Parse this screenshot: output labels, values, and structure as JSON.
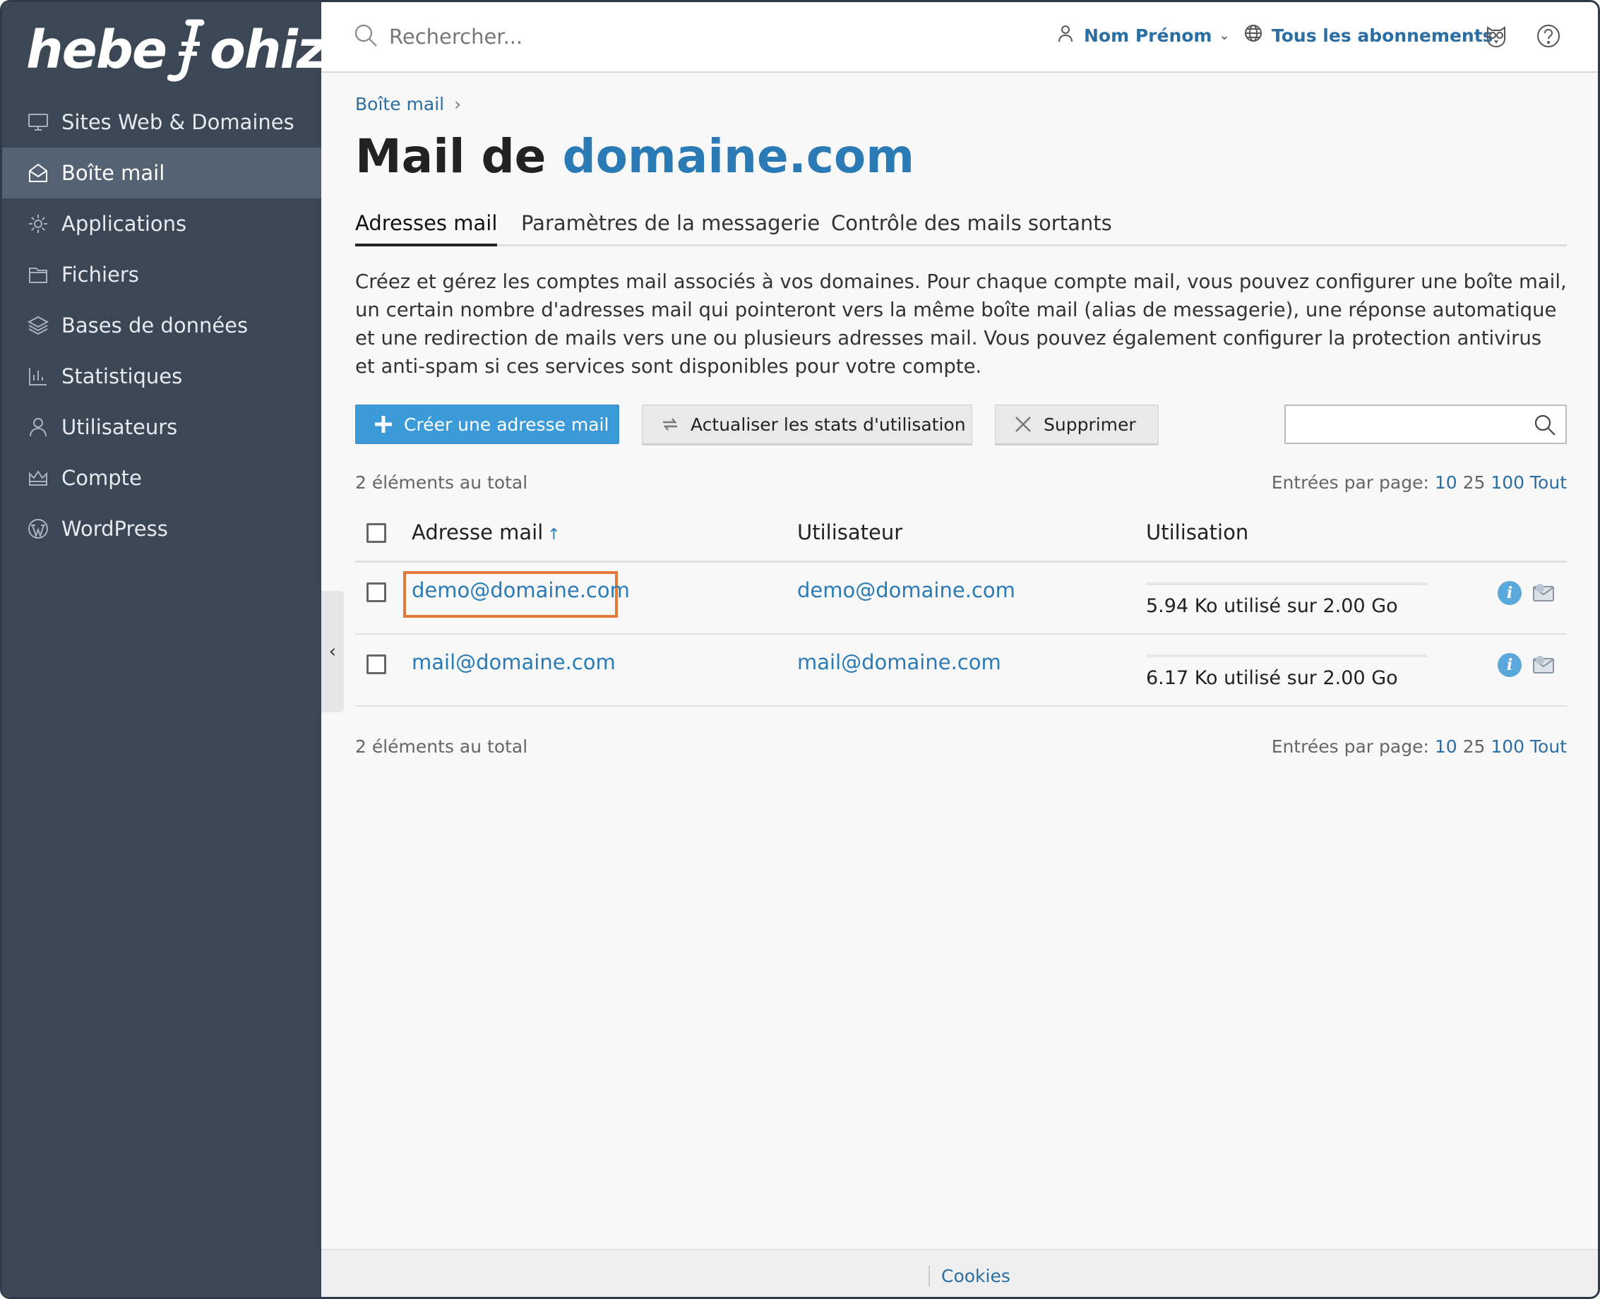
{
  "brand": {
    "logo_text_left": "hebe",
    "logo_text_right": "ohiz"
  },
  "sidebar": {
    "items": [
      {
        "label": "Sites Web & Domaines",
        "icon": "monitor-icon",
        "active": false
      },
      {
        "label": "Boîte mail",
        "icon": "mail-open-icon",
        "active": true
      },
      {
        "label": "Applications",
        "icon": "gear-icon",
        "active": false
      },
      {
        "label": "Fichiers",
        "icon": "folder-icon",
        "active": false
      },
      {
        "label": "Bases de données",
        "icon": "layers-icon",
        "active": false
      },
      {
        "label": "Statistiques",
        "icon": "bar-chart-icon",
        "active": false
      },
      {
        "label": "Utilisateurs",
        "icon": "user-icon",
        "active": false
      },
      {
        "label": "Compte",
        "icon": "crown-icon",
        "active": false
      },
      {
        "label": "WordPress",
        "icon": "wordpress-icon",
        "active": false
      }
    ],
    "collapse_glyph": "‹"
  },
  "header": {
    "search_placeholder": "Rechercher...",
    "user_name": "Nom Prénom",
    "subscriptions_label": "Tous les abonnements"
  },
  "main": {
    "breadcrumb": "Boîte mail",
    "title_prefix": "Mail de",
    "title_domain": "domaine.com",
    "tabs": [
      {
        "label": "Adresses mail",
        "active": true
      },
      {
        "label": "Paramètres de la messagerie",
        "active": false
      },
      {
        "label": "Contrôle des mails sortants",
        "active": false
      }
    ],
    "description": "Créez et gérez les comptes mail associés à vos domaines. Pour chaque compte mail, vous pouvez configurer une boîte mail, un certain nombre d'adresses mail qui pointeront vers la même boîte mail (alias de messagerie), une réponse automatique et une redirection de mails vers une ou plusieurs adresses mail. Vous pouvez également configurer la protection antivirus et anti-spam si ces services sont disponibles pour votre compte.",
    "toolbar": {
      "create_label": "Créer une adresse mail",
      "refresh_label": "Actualiser les stats d'utilisation",
      "delete_label": "Supprimer"
    },
    "total_label": "2 éléments au total",
    "per_page_label": "Entrées par page:",
    "per_page_options": [
      "10",
      "25",
      "100",
      "Tout"
    ],
    "table": {
      "columns": [
        "Adresse mail",
        "Utilisateur",
        "Utilisation"
      ],
      "sort_glyph": "↑",
      "rows": [
        {
          "email": "demo@domaine.com",
          "user": "demo@domaine.com",
          "usage": "5.94 Ko utilisé sur 2.00 Go",
          "usage_fraction": 0.0,
          "highlighted": true
        },
        {
          "email": "mail@domaine.com",
          "user": "mail@domaine.com",
          "usage": "6.17 Ko utilisé sur 2.00 Go",
          "usage_fraction": 0.0,
          "highlighted": false
        }
      ]
    }
  },
  "footer": {
    "cookies_label": "Cookies"
  },
  "colors": {
    "sidebar_bg": "#3c4756",
    "sidebar_active": "#556273",
    "link": "#2a7bb5",
    "primary_button": "#3c9ad8",
    "highlight": "#e47a3a"
  }
}
